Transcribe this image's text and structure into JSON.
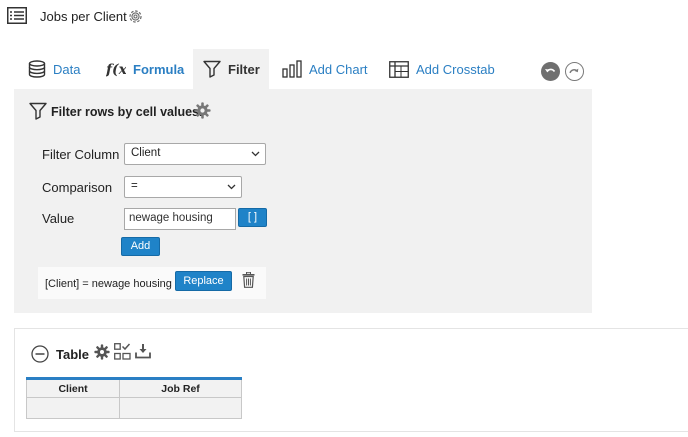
{
  "header": {
    "title": "Jobs per Client"
  },
  "tabs": [
    {
      "label": "Data",
      "icon": "database-icon"
    },
    {
      "label": "Formula",
      "icon": "function-icon"
    },
    {
      "label": "Filter",
      "icon": "funnel-icon"
    },
    {
      "label": "Add Chart",
      "icon": "bar-chart-icon"
    },
    {
      "label": "Add Crosstab",
      "icon": "crosstab-icon"
    }
  ],
  "filter": {
    "title": "Filter rows by cell values.",
    "column_label": "Filter Column",
    "column_value": "Client",
    "comparison_label": "Comparison",
    "comparison_value": "=",
    "value_label": "Value",
    "value_input": "newage housing",
    "bracket_label": "[ ]",
    "add_label": "Add",
    "rule_text": "[Client] = newage housing",
    "replace_label": "Replace"
  },
  "table_panel": {
    "title": "Table",
    "columns": [
      "Client",
      "Job Ref"
    ],
    "rows": [
      [
        "",
        ""
      ]
    ]
  },
  "colors": {
    "accent": "#1f83c8",
    "link": "#2b7fc3",
    "panel_bg": "#f1f1f1"
  }
}
